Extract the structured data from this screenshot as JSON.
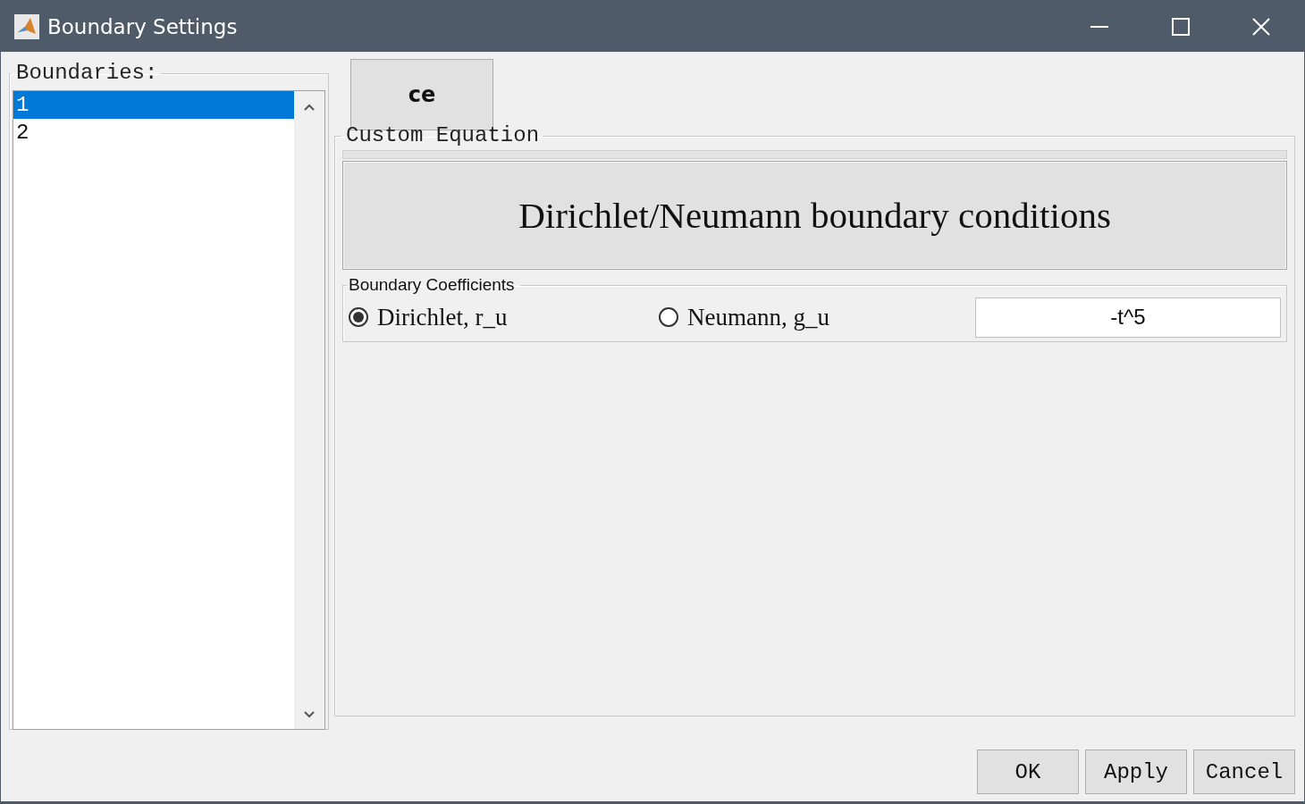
{
  "window": {
    "title": "Boundary Settings"
  },
  "boundaries": {
    "label": "Boundaries:",
    "items": [
      {
        "text": "1",
        "selected": true
      },
      {
        "text": "2",
        "selected": false
      }
    ]
  },
  "mode_button": "ce",
  "custom_equation": {
    "label": "Custom Equation",
    "heading": "Dirichlet/Neumann boundary conditions",
    "coefficients": {
      "label": "Boundary Coefficients",
      "options": [
        {
          "label": "Dirichlet, r_u",
          "selected": true
        },
        {
          "label": "Neumann, g_u",
          "selected": false
        }
      ],
      "value": "-t^5"
    }
  },
  "buttons": [
    "OK",
    "Apply",
    "Cancel"
  ]
}
